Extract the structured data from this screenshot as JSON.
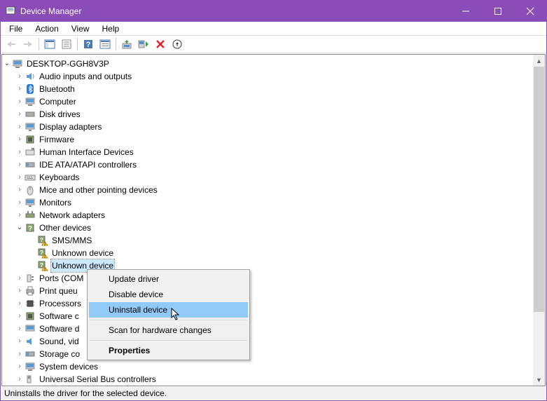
{
  "window": {
    "title": "Device Manager"
  },
  "menu": {
    "items": [
      "File",
      "Action",
      "View",
      "Help"
    ]
  },
  "tree": {
    "root": "DESKTOP-GGH8V3P",
    "items": [
      "Audio inputs and outputs",
      "Bluetooth",
      "Computer",
      "Disk drives",
      "Display adapters",
      "Firmware",
      "Human Interface Devices",
      "IDE ATA/ATAPI controllers",
      "Keyboards",
      "Mice and other pointing devices",
      "Monitors",
      "Network adapters"
    ],
    "other": {
      "label": "Other devices",
      "children": [
        "SMS/MMS",
        "Unknown device",
        "Unknown device"
      ]
    },
    "rest": [
      "Ports (COM",
      "Print queu",
      "Processors",
      "Software c",
      "Software d",
      "Sound, vid",
      "Storage co",
      "System devices",
      "Universal Serial Bus controllers"
    ]
  },
  "context": {
    "items": [
      "Update driver",
      "Disable device",
      "Uninstall device",
      "Scan for hardware changes",
      "Properties"
    ]
  },
  "status": "Uninstalls the driver for the selected device."
}
